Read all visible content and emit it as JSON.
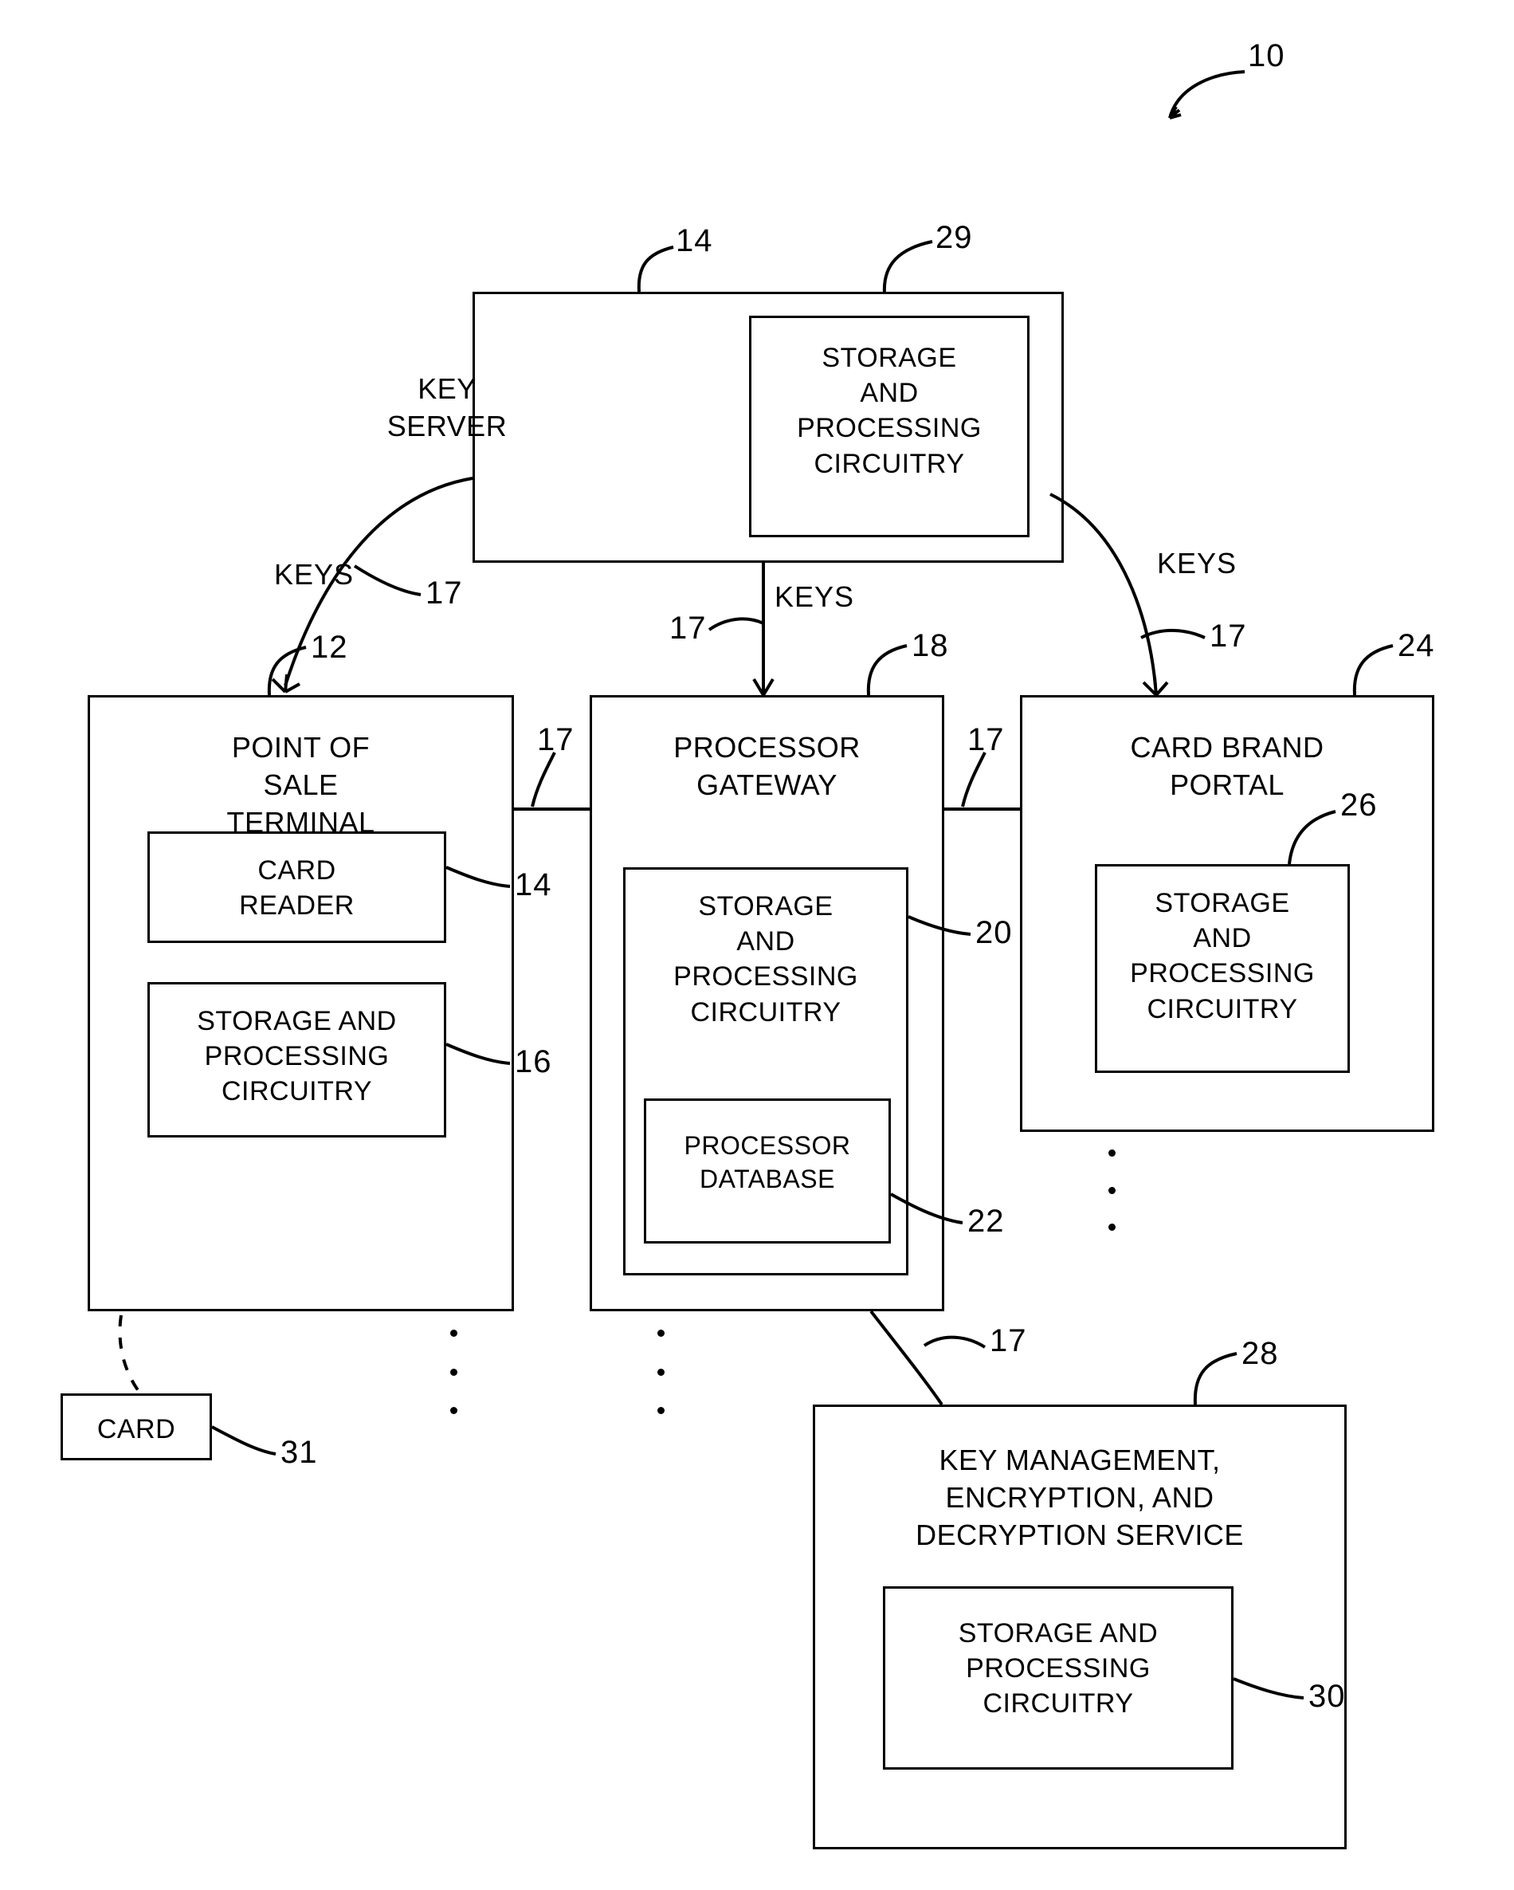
{
  "figure": {
    "figure_ref": "10",
    "boxes": [
      {
        "id": "key-server",
        "label": "KEY\nSERVER",
        "ref": "14"
      },
      {
        "id": "key-server-storage",
        "label": "STORAGE\nAND\nPROCESSING\nCIRCUITRY",
        "ref": "29"
      },
      {
        "id": "pos-terminal",
        "label": "POINT OF\nSALE\nTERMINAL",
        "ref": "12"
      },
      {
        "id": "card-reader",
        "label": "CARD\nREADER",
        "ref": "14"
      },
      {
        "id": "pos-storage",
        "label": "STORAGE AND\nPROCESSING\nCIRCUITRY",
        "ref": "16"
      },
      {
        "id": "processor-gateway",
        "label": "PROCESSOR\nGATEWAY",
        "ref": "18"
      },
      {
        "id": "gateway-storage",
        "label": "STORAGE\nAND\nPROCESSING\nCIRCUITRY",
        "ref": "20"
      },
      {
        "id": "processor-database",
        "label": "PROCESSOR\nDATABASE",
        "ref": "22"
      },
      {
        "id": "card-brand-portal",
        "label": "CARD BRAND\nPORTAL",
        "ref": "24"
      },
      {
        "id": "portal-storage",
        "label": "STORAGE\nAND\nPROCESSING\nCIRCUITRY",
        "ref": "26"
      },
      {
        "id": "key-service",
        "label": "KEY MANAGEMENT,\nENCRYPTION, AND\nDECRYPTION SERVICE",
        "ref": "28"
      },
      {
        "id": "key-service-storage",
        "label": "STORAGE AND\nPROCESSING\nCIRCUITRY",
        "ref": "30"
      },
      {
        "id": "card",
        "label": "CARD",
        "ref": "31"
      }
    ],
    "arrows": [
      {
        "id": "keys-left",
        "label": "KEYS",
        "ref": "17"
      },
      {
        "id": "keys-center",
        "label": "KEYS",
        "ref": "17"
      },
      {
        "id": "keys-right",
        "label": "KEYS",
        "ref": "17"
      }
    ],
    "connector_refs": [
      {
        "id": "pos-gateway-link",
        "ref": "17"
      },
      {
        "id": "gateway-portal-link",
        "ref": "17"
      },
      {
        "id": "gateway-service-link",
        "ref": "17"
      }
    ]
  }
}
